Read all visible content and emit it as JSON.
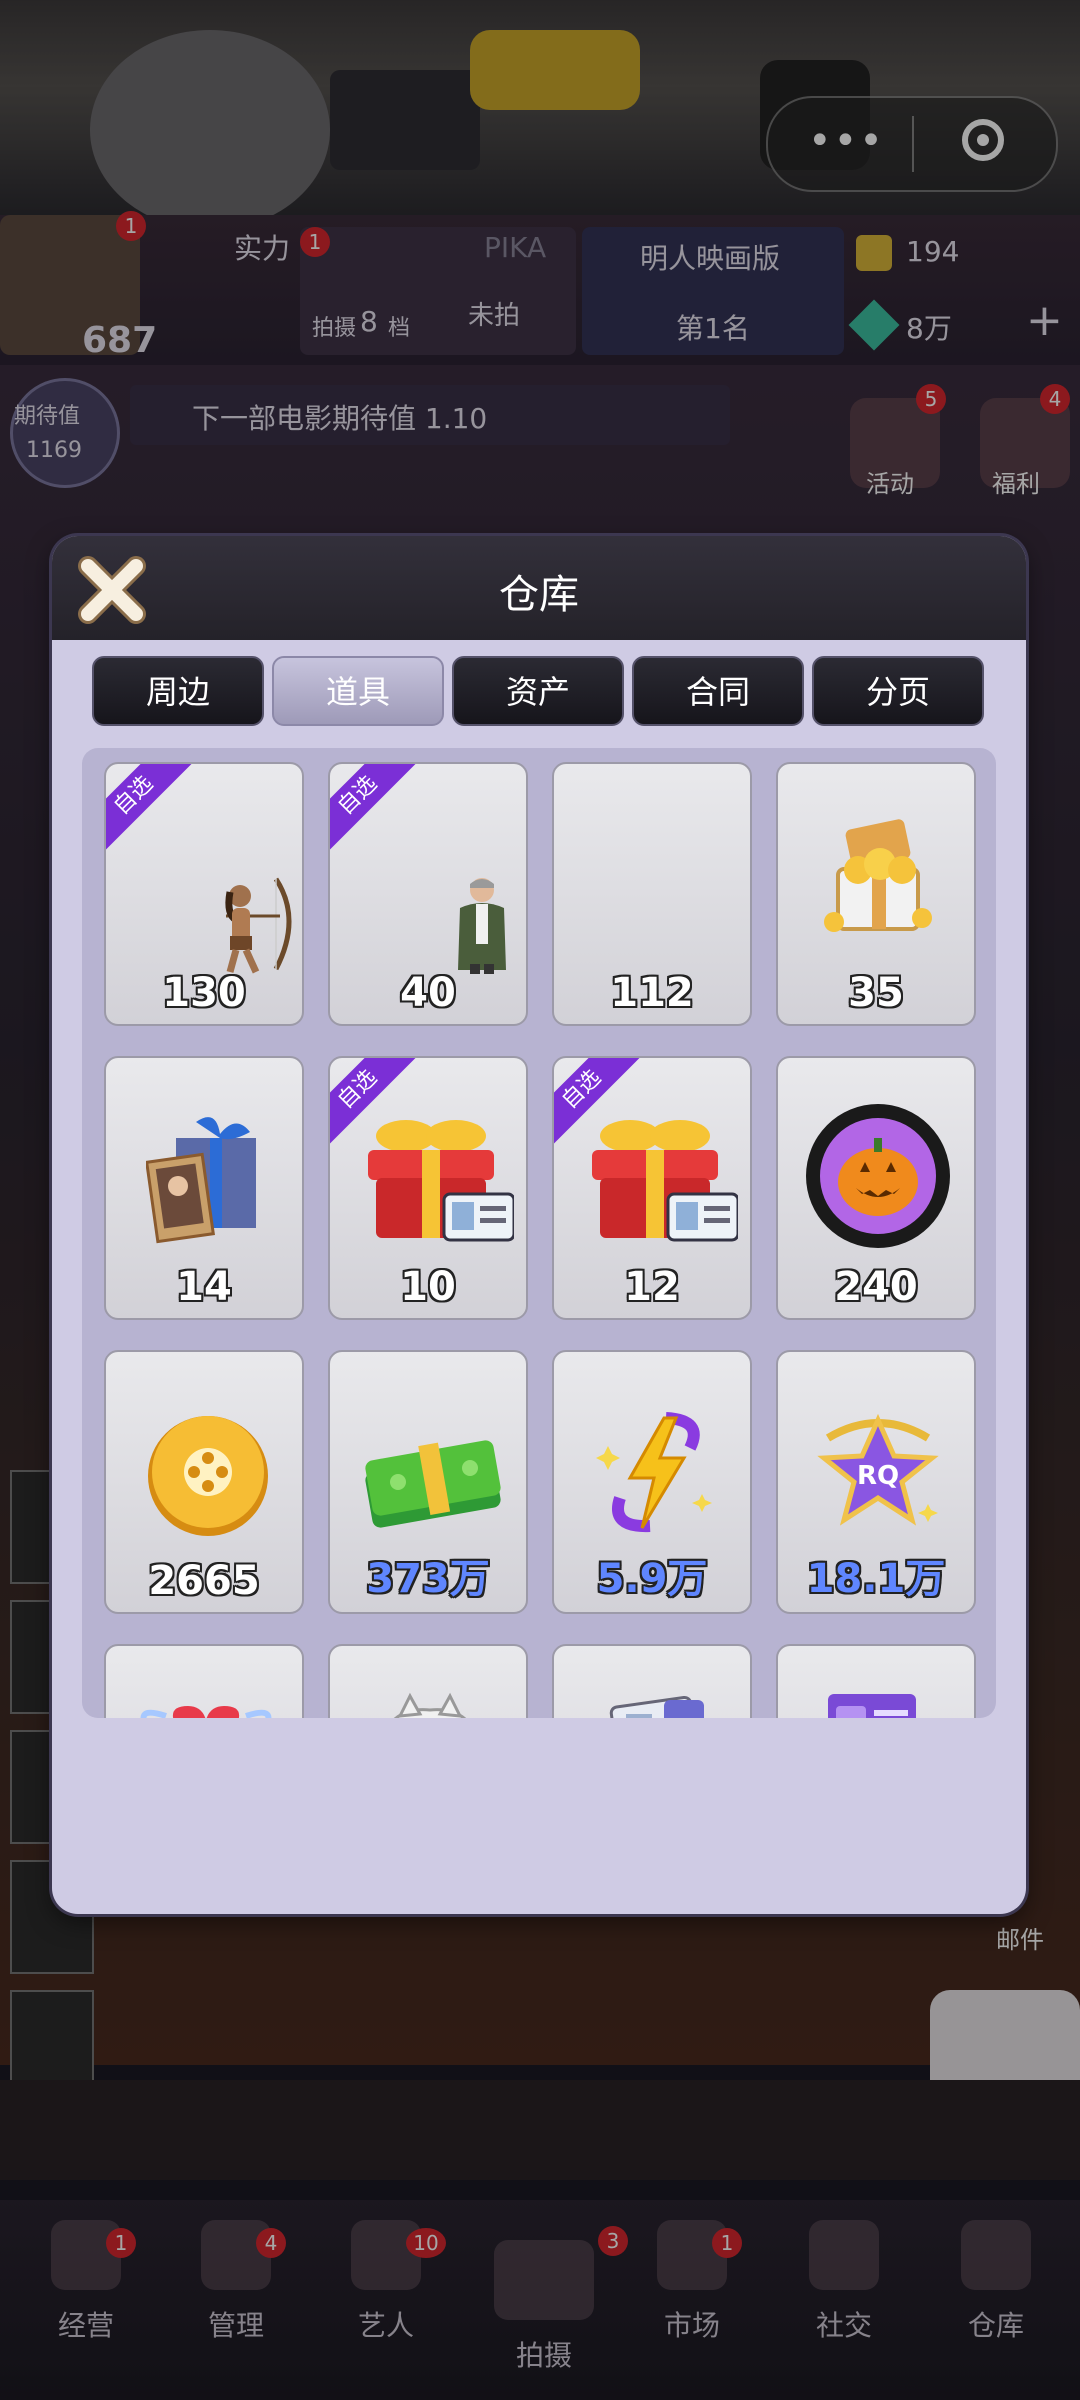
{
  "status": {
    "capsule_dots": "•••"
  },
  "hud": {
    "power_label": "实力",
    "player_score": "687",
    "pika_label": "PIKA",
    "film_count_prefix": "拍摄",
    "film_count": "8",
    "film_count_suffix": "档",
    "unshot_label": "未拍",
    "ranking_title": "明人映画版",
    "rank_label": "第1名",
    "currency1": "194",
    "currency2": "8万",
    "badge1": "1",
    "badge2": "1",
    "expect_label": "期待值",
    "expect_value": "1169",
    "news_text": "下一部电影期待值 1.10",
    "activity_label": "活动",
    "activity_badge": "5",
    "welfare_label": "福利",
    "welfare_badge": "4",
    "mail_label": "邮件"
  },
  "dialog": {
    "title": "仓库",
    "tabs": [
      {
        "label": "周边",
        "active": false
      },
      {
        "label": "道具",
        "active": true
      },
      {
        "label": "资产",
        "active": false
      },
      {
        "label": "合同",
        "active": false
      },
      {
        "label": "分页",
        "active": false
      }
    ],
    "badge_text": "自选",
    "items": [
      {
        "icon": "archer-figure-icon",
        "count": "130",
        "selectable": true
      },
      {
        "icon": "man-in-jacket-icon",
        "count": "40",
        "selectable": true
      },
      {
        "icon": "blank-item-icon",
        "count": "112",
        "selectable": false
      },
      {
        "icon": "gold-treasure-chest-icon",
        "count": "35",
        "selectable": false
      },
      {
        "icon": "photo-gift-box-icon",
        "count": "14",
        "selectable": false
      },
      {
        "icon": "red-gift-box-with-card-icon",
        "count": "10",
        "selectable": true
      },
      {
        "icon": "red-gift-box-with-card-icon",
        "count": "12",
        "selectable": true
      },
      {
        "icon": "pumpkin-token-icon",
        "count": "240",
        "selectable": false
      },
      {
        "icon": "gold-film-coin-icon",
        "count": "2665",
        "selectable": false
      },
      {
        "icon": "cash-stack-icon",
        "count": "373万",
        "selectable": false
      },
      {
        "icon": "lightning-energy-icon",
        "count": "5.9万",
        "selectable": false
      },
      {
        "icon": "rq-star-icon",
        "count": "18.1万",
        "selectable": false
      },
      {
        "icon": "heart-wings-icon",
        "count": "",
        "selectable": false
      },
      {
        "icon": "cat-icon",
        "count": "",
        "selectable": false
      },
      {
        "icon": "id-card-icon",
        "count": "",
        "selectable": false
      },
      {
        "icon": "purple-card-icon",
        "count": "",
        "selectable": false
      }
    ]
  },
  "nav": {
    "items": [
      {
        "label": "经营",
        "badge": "1"
      },
      {
        "label": "管理",
        "badge": "4"
      },
      {
        "label": "艺人",
        "badge": "10"
      },
      {
        "label": "拍摄",
        "badge": "3"
      },
      {
        "label": "市场",
        "badge": "1"
      },
      {
        "label": "社交",
        "badge": ""
      },
      {
        "label": "仓库",
        "badge": ""
      }
    ]
  },
  "colors": {
    "dialog_bg": "#cfcbe4",
    "header_bg": "#2a2830",
    "badge_purple": "#7b2fd6",
    "count_blue": "#5f86ff"
  }
}
